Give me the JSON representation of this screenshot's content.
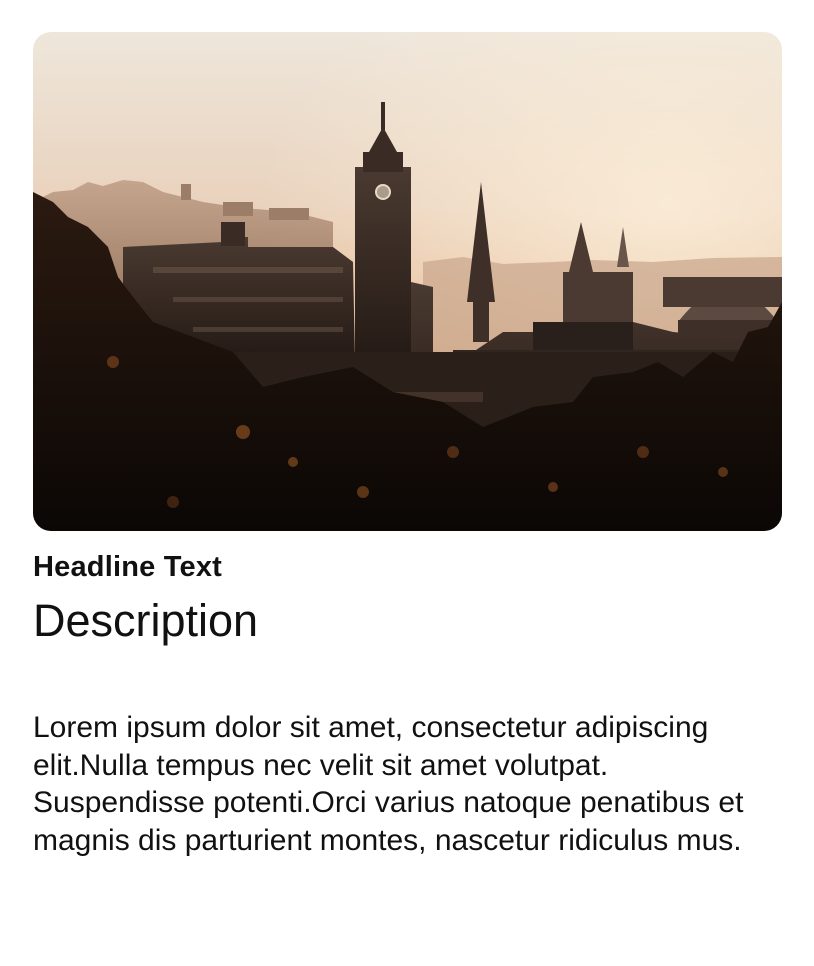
{
  "card": {
    "image_alt": "City skyline at sunset with clock tower",
    "headline": "Headline Text",
    "description": "Description",
    "body": "Lorem ipsum dolor sit amet, consectetur adipiscing elit.Nulla tempus nec velit sit amet volutpat. Suspendisse potenti.Orci varius natoque penatibus et magnis dis parturient montes, nascetur ridiculus mus."
  },
  "colors": {
    "text": "#111111",
    "sky_top": "#e7dccd",
    "sky_bottom": "#f1c9a2",
    "silhouette": "#2a1e17",
    "foliage": "#140d09"
  },
  "icons": {
    "photo": "city-photo"
  }
}
